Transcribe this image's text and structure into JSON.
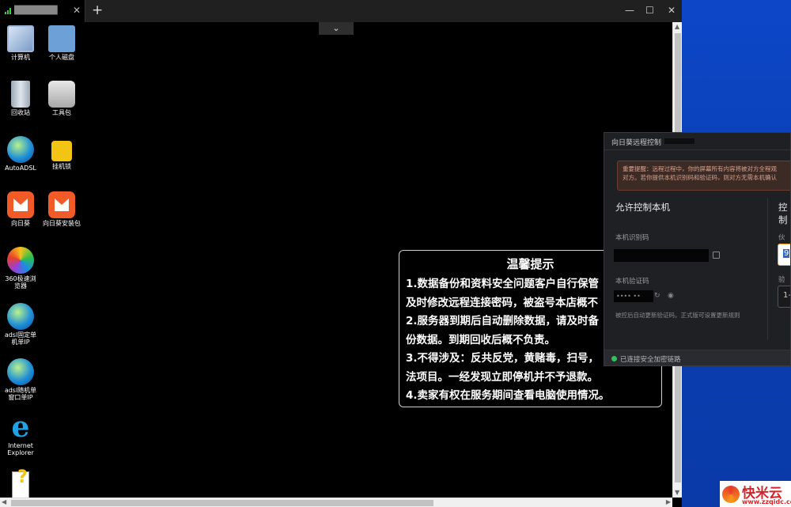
{
  "window": {
    "tab_title": "████████",
    "tab_close": "✕",
    "new_tab": "+",
    "minimize": "—",
    "maximize": "☐",
    "close": "✕",
    "dropdown": "⌄"
  },
  "desktop_icons": [
    {
      "label": "计算机",
      "icon": "computer-icon"
    },
    {
      "label": "个人磁盘",
      "icon": "personal-disk-icon"
    },
    {
      "label": "回收站",
      "icon": "recycle-bin-icon"
    },
    {
      "label": "工具包",
      "icon": "toolkit-icon"
    },
    {
      "label": "AutoADSL",
      "icon": "autoadsl-icon"
    },
    {
      "label": "挂机锁",
      "icon": "lock-icon"
    },
    {
      "label": "向日葵",
      "icon": "sunlogin-icon"
    },
    {
      "label": "向日葵安装包",
      "icon": "sunlogin-installer-icon"
    },
    {
      "label": "360极速浏览器",
      "icon": "browser-360-icon"
    },
    {
      "label": "adsl固定单机单IP",
      "icon": "adsl-fixed-icon"
    },
    {
      "label": "adsl随机单窗口单IP",
      "icon": "adsl-random-icon"
    },
    {
      "label": "Internet Explorer",
      "icon": "ie-icon"
    },
    {
      "label": "",
      "icon": "help-doc-icon"
    }
  ],
  "notice": {
    "title": "温馨提示",
    "lines": [
      " 1.数据备份和资料安全问题客户自行保管",
      "及时修改远程连接密码，被盗号本店概不",
      "2.服务器到期后自动删除数据，请及时备",
      "份数据。到期回收后概不负责。",
      "3.不得涉及：反共反党，黄赌毒，扫号，",
      "法项目。一经发现立即停机并不予退款。",
      "4.卖家有权在服务期间查看电脑使用情况。"
    ]
  },
  "sunlogin": {
    "title": "向日葵远程控制",
    "warning_line1": "重要提醒：远程过程中，你的屏幕所有内容将被对方全程观",
    "warning_line2": "对方。若你提供本机识别码和验证码，则对方无需本机确认",
    "allow_control": "允许控制本机",
    "control_other": "控制",
    "device_id_label": "本机识别码",
    "verify_code_label": "本机验证码",
    "verify_code_value": "•••• ••",
    "note": "被控后自动更新验证码。正式版可设置更新规则",
    "partner_label": "伙伴",
    "partner_value": "9",
    "verify_label": "验证",
    "verify_value": "1-",
    "status": "已连接安全加密链路"
  },
  "watermark": {
    "name": "快米云",
    "url": "www.zzqidc.com"
  },
  "colors": {
    "accent_orange": "#f2a23a",
    "status_green": "#2ec45a",
    "desktop_blue": "#0a3aa8"
  }
}
